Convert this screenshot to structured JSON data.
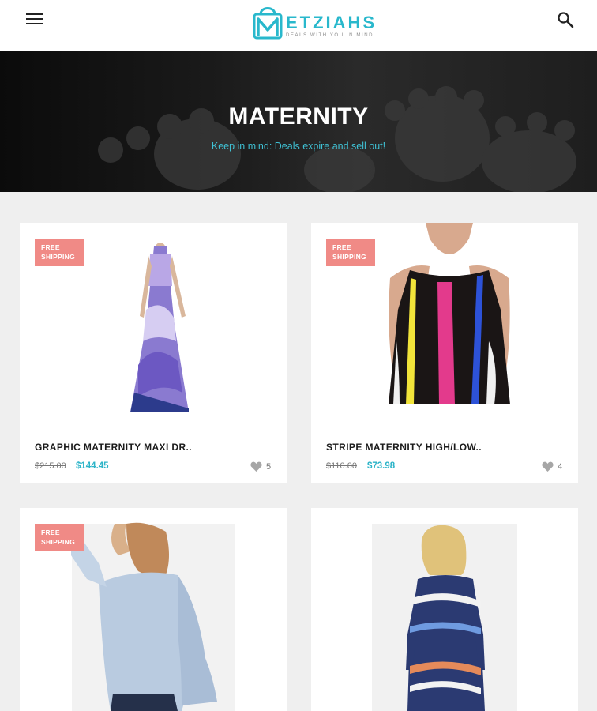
{
  "header": {
    "menu_icon": "hamburger-menu-icon",
    "search_icon": "search-icon",
    "logo": {
      "word": "ETZIAHS",
      "tagline": "DEALS WITH YOU IN MIND"
    }
  },
  "hero": {
    "title": "MATERNITY",
    "subtitle": "Keep in mind: Deals expire and sell out!"
  },
  "products": [
    {
      "badge": "FREE SHIPPING",
      "name": "GRAPHIC MATERNITY MAXI DR..",
      "old_price": "$215.00",
      "new_price": "$144.45",
      "likes": "5"
    },
    {
      "badge": "FREE SHIPPING",
      "name": "STRIPE MATERNITY HIGH/LOW..",
      "old_price": "$110.00",
      "new_price": "$73.98",
      "likes": "4"
    },
    {
      "badge": "FREE SHIPPING"
    },
    {}
  ],
  "colors": {
    "accent": "#29b8cc",
    "badge": "#f08a86",
    "hero_bg": "#151515",
    "page_bg": "#efefef"
  }
}
